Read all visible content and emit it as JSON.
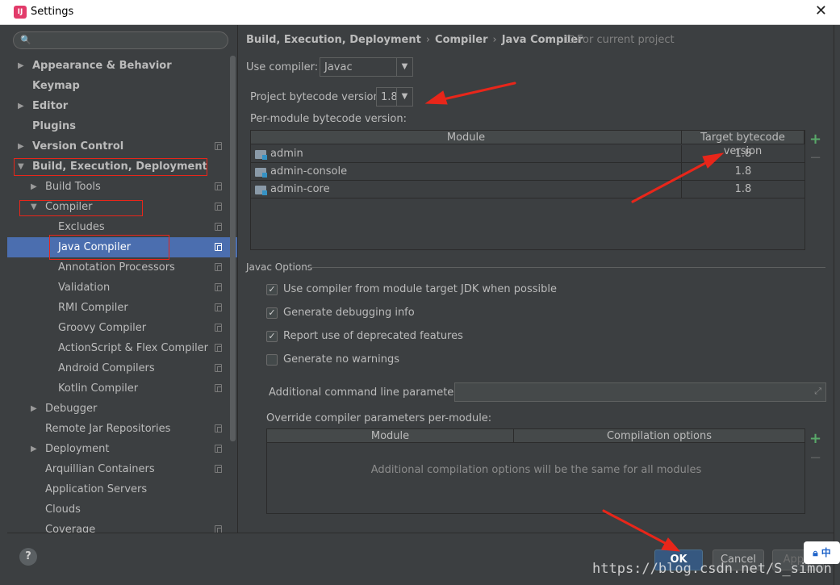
{
  "window": {
    "title": "Settings",
    "close": "✕"
  },
  "search": {
    "placeholder": "",
    "icon": "🔍"
  },
  "sidebar": {
    "items": [
      {
        "label": "Appearance & Behavior",
        "level": 0,
        "arrow": "▶",
        "bold": true,
        "copy": false
      },
      {
        "label": "Keymap",
        "level": 0,
        "arrow": "",
        "bold": true,
        "copy": false
      },
      {
        "label": "Editor",
        "level": 0,
        "arrow": "▶",
        "bold": true,
        "copy": false
      },
      {
        "label": "Plugins",
        "level": 0,
        "arrow": "",
        "bold": true,
        "copy": false
      },
      {
        "label": "Version Control",
        "level": 0,
        "arrow": "▶",
        "bold": true,
        "copy": true
      },
      {
        "label": "Build, Execution, Deployment",
        "level": 0,
        "arrow": "▼",
        "bold": true,
        "copy": false
      },
      {
        "label": "Build Tools",
        "level": 1,
        "arrow": "▶",
        "bold": false,
        "copy": true
      },
      {
        "label": "Compiler",
        "level": 1,
        "arrow": "▼",
        "bold": false,
        "copy": true
      },
      {
        "label": "Excludes",
        "level": 2,
        "arrow": "",
        "bold": false,
        "copy": true
      },
      {
        "label": "Java Compiler",
        "level": 2,
        "arrow": "",
        "bold": false,
        "copy": true,
        "selected": true
      },
      {
        "label": "Annotation Processors",
        "level": 2,
        "arrow": "",
        "bold": false,
        "copy": true
      },
      {
        "label": "Validation",
        "level": 2,
        "arrow": "",
        "bold": false,
        "copy": true
      },
      {
        "label": "RMI Compiler",
        "level": 2,
        "arrow": "",
        "bold": false,
        "copy": true
      },
      {
        "label": "Groovy Compiler",
        "level": 2,
        "arrow": "",
        "bold": false,
        "copy": true
      },
      {
        "label": "ActionScript & Flex Compiler",
        "level": 2,
        "arrow": "",
        "bold": false,
        "copy": true
      },
      {
        "label": "Android Compilers",
        "level": 2,
        "arrow": "",
        "bold": false,
        "copy": true
      },
      {
        "label": "Kotlin Compiler",
        "level": 2,
        "arrow": "",
        "bold": false,
        "copy": true
      },
      {
        "label": "Debugger",
        "level": 1,
        "arrow": "▶",
        "bold": false,
        "copy": false
      },
      {
        "label": "Remote Jar Repositories",
        "level": 1,
        "arrow": "",
        "bold": false,
        "copy": true
      },
      {
        "label": "Deployment",
        "level": 1,
        "arrow": "▶",
        "bold": false,
        "copy": true
      },
      {
        "label": "Arquillian Containers",
        "level": 1,
        "arrow": "",
        "bold": false,
        "copy": true
      },
      {
        "label": "Application Servers",
        "level": 1,
        "arrow": "",
        "bold": false,
        "copy": false
      },
      {
        "label": "Clouds",
        "level": 1,
        "arrow": "",
        "bold": false,
        "copy": false
      },
      {
        "label": "Coverage",
        "level": 1,
        "arrow": "",
        "bold": false,
        "copy": true
      }
    ]
  },
  "breadcrumb": {
    "parts": [
      "Build, Execution, Deployment",
      "Compiler",
      "Java Compiler"
    ],
    "separator": "›",
    "scope": "For current project"
  },
  "compiler": {
    "use_label": "Use compiler:",
    "use_value": "Javac",
    "dropdown_arrow": "▼",
    "bytecode_label": "Project bytecode version:",
    "bytecode_value": "1.8",
    "per_module_label": "Per-module bytecode version:"
  },
  "module_table": {
    "headers": [
      "Module",
      "Target bytecode version"
    ],
    "rows": [
      {
        "module": "admin",
        "version": "1.8"
      },
      {
        "module": "admin-console",
        "version": "1.8"
      },
      {
        "module": "admin-core",
        "version": "1.8"
      }
    ],
    "add": "+",
    "remove": "−"
  },
  "javac": {
    "group_title": "Javac Options",
    "checkboxes": [
      {
        "label": "Use compiler from module target JDK when possible",
        "checked": true
      },
      {
        "label": "Generate debugging info",
        "checked": true
      },
      {
        "label": "Report use of deprecated features",
        "checked": true
      },
      {
        "label": "Generate no warnings",
        "checked": false
      }
    ],
    "additional_label": "Additional command line parameters:",
    "additional_value": "",
    "expand_icon": "⤢",
    "override_label": "Override compiler parameters per-module:"
  },
  "override_table": {
    "headers": [
      "Module",
      "Compilation options"
    ],
    "empty_text": "Additional compilation options will be the same for all modules",
    "add": "+",
    "remove": "−"
  },
  "buttons": {
    "help": "?",
    "ok": "OK",
    "cancel": "Cancel",
    "apply": "Apply"
  },
  "overlay": {
    "ime": "中",
    "watermark": "https://blog.csdn.net/S_simon"
  },
  "colors": {
    "accent": "#4b6eaf",
    "annotation": "#e8261a",
    "add": "#59a869",
    "ok": "#365880"
  }
}
